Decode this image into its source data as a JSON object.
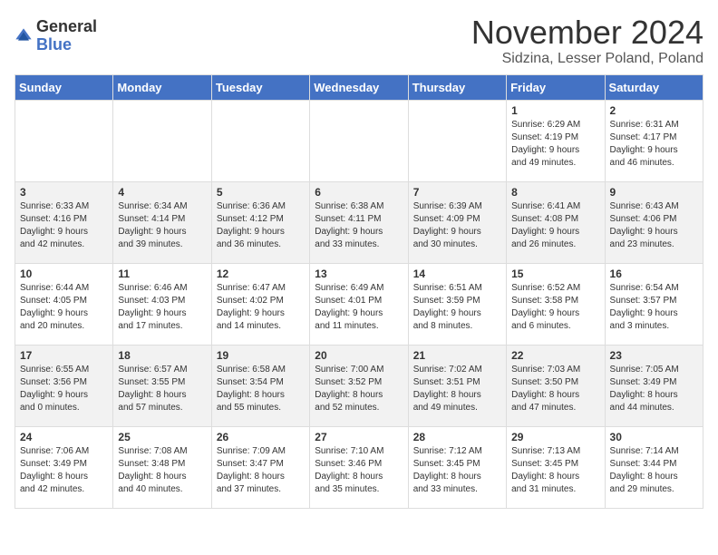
{
  "header": {
    "logo_general": "General",
    "logo_blue": "Blue",
    "month_title": "November 2024",
    "location": "Sidzina, Lesser Poland, Poland"
  },
  "days_of_week": [
    "Sunday",
    "Monday",
    "Tuesday",
    "Wednesday",
    "Thursday",
    "Friday",
    "Saturday"
  ],
  "weeks": [
    [
      {
        "day": "",
        "info": ""
      },
      {
        "day": "",
        "info": ""
      },
      {
        "day": "",
        "info": ""
      },
      {
        "day": "",
        "info": ""
      },
      {
        "day": "",
        "info": ""
      },
      {
        "day": "1",
        "info": "Sunrise: 6:29 AM\nSunset: 4:19 PM\nDaylight: 9 hours\nand 49 minutes."
      },
      {
        "day": "2",
        "info": "Sunrise: 6:31 AM\nSunset: 4:17 PM\nDaylight: 9 hours\nand 46 minutes."
      }
    ],
    [
      {
        "day": "3",
        "info": "Sunrise: 6:33 AM\nSunset: 4:16 PM\nDaylight: 9 hours\nand 42 minutes."
      },
      {
        "day": "4",
        "info": "Sunrise: 6:34 AM\nSunset: 4:14 PM\nDaylight: 9 hours\nand 39 minutes."
      },
      {
        "day": "5",
        "info": "Sunrise: 6:36 AM\nSunset: 4:12 PM\nDaylight: 9 hours\nand 36 minutes."
      },
      {
        "day": "6",
        "info": "Sunrise: 6:38 AM\nSunset: 4:11 PM\nDaylight: 9 hours\nand 33 minutes."
      },
      {
        "day": "7",
        "info": "Sunrise: 6:39 AM\nSunset: 4:09 PM\nDaylight: 9 hours\nand 30 minutes."
      },
      {
        "day": "8",
        "info": "Sunrise: 6:41 AM\nSunset: 4:08 PM\nDaylight: 9 hours\nand 26 minutes."
      },
      {
        "day": "9",
        "info": "Sunrise: 6:43 AM\nSunset: 4:06 PM\nDaylight: 9 hours\nand 23 minutes."
      }
    ],
    [
      {
        "day": "10",
        "info": "Sunrise: 6:44 AM\nSunset: 4:05 PM\nDaylight: 9 hours\nand 20 minutes."
      },
      {
        "day": "11",
        "info": "Sunrise: 6:46 AM\nSunset: 4:03 PM\nDaylight: 9 hours\nand 17 minutes."
      },
      {
        "day": "12",
        "info": "Sunrise: 6:47 AM\nSunset: 4:02 PM\nDaylight: 9 hours\nand 14 minutes."
      },
      {
        "day": "13",
        "info": "Sunrise: 6:49 AM\nSunset: 4:01 PM\nDaylight: 9 hours\nand 11 minutes."
      },
      {
        "day": "14",
        "info": "Sunrise: 6:51 AM\nSunset: 3:59 PM\nDaylight: 9 hours\nand 8 minutes."
      },
      {
        "day": "15",
        "info": "Sunrise: 6:52 AM\nSunset: 3:58 PM\nDaylight: 9 hours\nand 6 minutes."
      },
      {
        "day": "16",
        "info": "Sunrise: 6:54 AM\nSunset: 3:57 PM\nDaylight: 9 hours\nand 3 minutes."
      }
    ],
    [
      {
        "day": "17",
        "info": "Sunrise: 6:55 AM\nSunset: 3:56 PM\nDaylight: 9 hours\nand 0 minutes."
      },
      {
        "day": "18",
        "info": "Sunrise: 6:57 AM\nSunset: 3:55 PM\nDaylight: 8 hours\nand 57 minutes."
      },
      {
        "day": "19",
        "info": "Sunrise: 6:58 AM\nSunset: 3:54 PM\nDaylight: 8 hours\nand 55 minutes."
      },
      {
        "day": "20",
        "info": "Sunrise: 7:00 AM\nSunset: 3:52 PM\nDaylight: 8 hours\nand 52 minutes."
      },
      {
        "day": "21",
        "info": "Sunrise: 7:02 AM\nSunset: 3:51 PM\nDaylight: 8 hours\nand 49 minutes."
      },
      {
        "day": "22",
        "info": "Sunrise: 7:03 AM\nSunset: 3:50 PM\nDaylight: 8 hours\nand 47 minutes."
      },
      {
        "day": "23",
        "info": "Sunrise: 7:05 AM\nSunset: 3:49 PM\nDaylight: 8 hours\nand 44 minutes."
      }
    ],
    [
      {
        "day": "24",
        "info": "Sunrise: 7:06 AM\nSunset: 3:49 PM\nDaylight: 8 hours\nand 42 minutes."
      },
      {
        "day": "25",
        "info": "Sunrise: 7:08 AM\nSunset: 3:48 PM\nDaylight: 8 hours\nand 40 minutes."
      },
      {
        "day": "26",
        "info": "Sunrise: 7:09 AM\nSunset: 3:47 PM\nDaylight: 8 hours\nand 37 minutes."
      },
      {
        "day": "27",
        "info": "Sunrise: 7:10 AM\nSunset: 3:46 PM\nDaylight: 8 hours\nand 35 minutes."
      },
      {
        "day": "28",
        "info": "Sunrise: 7:12 AM\nSunset: 3:45 PM\nDaylight: 8 hours\nand 33 minutes."
      },
      {
        "day": "29",
        "info": "Sunrise: 7:13 AM\nSunset: 3:45 PM\nDaylight: 8 hours\nand 31 minutes."
      },
      {
        "day": "30",
        "info": "Sunrise: 7:14 AM\nSunset: 3:44 PM\nDaylight: 8 hours\nand 29 minutes."
      }
    ]
  ]
}
